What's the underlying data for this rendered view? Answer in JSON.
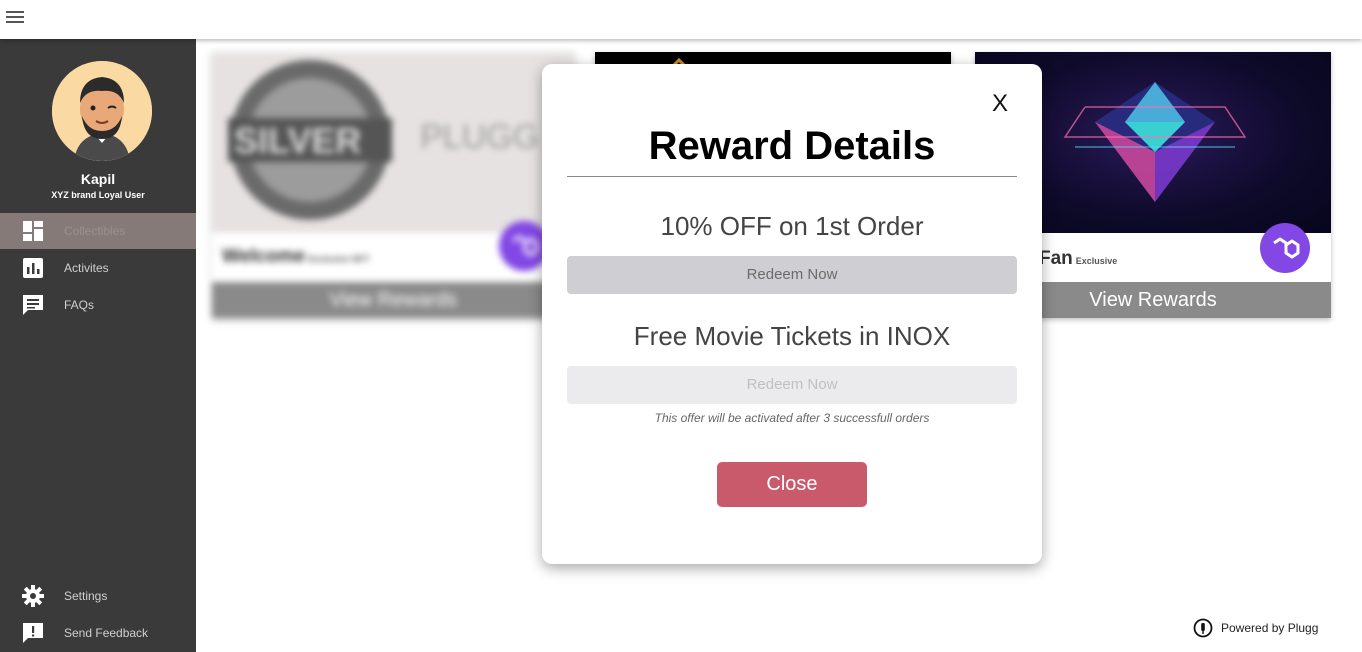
{
  "topbar": {
    "menu_icon": "hamburger-menu-icon"
  },
  "sidebar": {
    "user": {
      "name": "Kapil",
      "subtitle": "XYZ brand Loyal User"
    },
    "items": [
      {
        "label": "Collectibles",
        "icon": "dashboard-icon",
        "active": true
      },
      {
        "label": "Activites",
        "icon": "bar-chart-icon",
        "active": false
      },
      {
        "label": "FAQs",
        "icon": "chat-icon",
        "active": false
      }
    ],
    "bottom_items": [
      {
        "label": "Settings",
        "icon": "gear-icon"
      },
      {
        "label": "Send Feedback",
        "icon": "feedback-icon"
      }
    ]
  },
  "cards": [
    {
      "badge_text": "SILVER",
      "brand_text": "PLUGG",
      "title": "Welcome",
      "tag": "Exclusive NFT",
      "button": "View Rewards"
    },
    {
      "title": "",
      "button": ""
    },
    {
      "title": "Fan",
      "tag": "Exclusive",
      "button": "View Rewards"
    }
  ],
  "modal": {
    "close_x": "X",
    "title": "Reward Details",
    "offers": [
      {
        "title": "10% OFF on 1st Order",
        "button": "Redeem Now",
        "enabled": true
      },
      {
        "title": "Free Movie Tickets in INOX",
        "button": "Redeem Now",
        "enabled": false,
        "note": "This offer will be activated after 3 successfull orders"
      }
    ],
    "close_label": "Close"
  },
  "footer": {
    "powered_by": "Powered by Plugg"
  },
  "colors": {
    "sidebar": "#3a3a3a",
    "active_item": "#857a77",
    "close_button": "#c95a6b",
    "polygon": "#8247e5"
  }
}
